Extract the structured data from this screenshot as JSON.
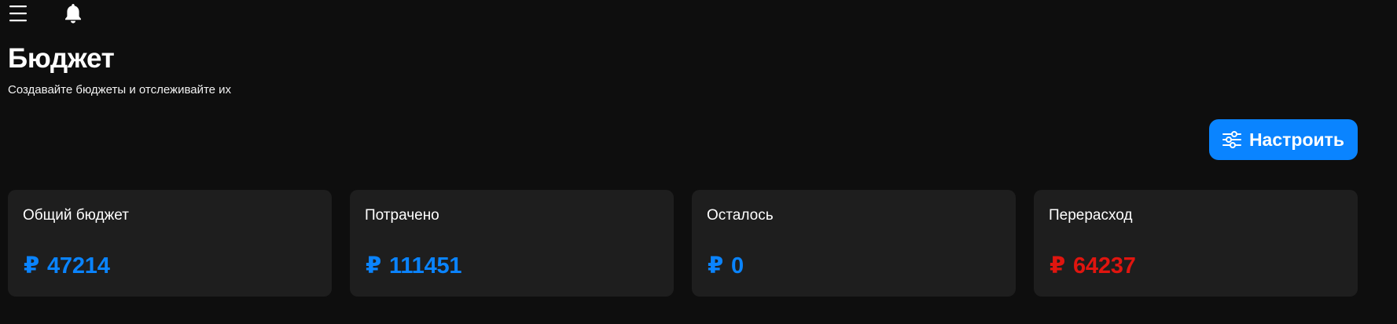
{
  "header": {
    "title": "Бюджет",
    "subtitle": "Создавайте бюджеты и отслеживайте их"
  },
  "topbar": {
    "menu_icon": "hamburger-menu-icon",
    "notification_icon": "bell-icon"
  },
  "actions": {
    "configure_label": "Настроить",
    "configure_icon": "sliders-icon"
  },
  "cards": [
    {
      "label": "Общий бюджет",
      "currency": "₽",
      "value": "47214",
      "color": "#0a84ff"
    },
    {
      "label": "Потрачено",
      "currency": "₽",
      "value": "111451",
      "color": "#0a84ff"
    },
    {
      "label": "Осталось",
      "currency": "₽",
      "value": "0",
      "color": "#0a84ff"
    },
    {
      "label": "Перерасход",
      "currency": "₽",
      "value": "64237",
      "color": "#e0150f"
    }
  ],
  "colors": {
    "background": "#0e0e0e",
    "card_background": "#1e1e1e",
    "accent": "#0a84ff",
    "danger": "#e0150f"
  }
}
